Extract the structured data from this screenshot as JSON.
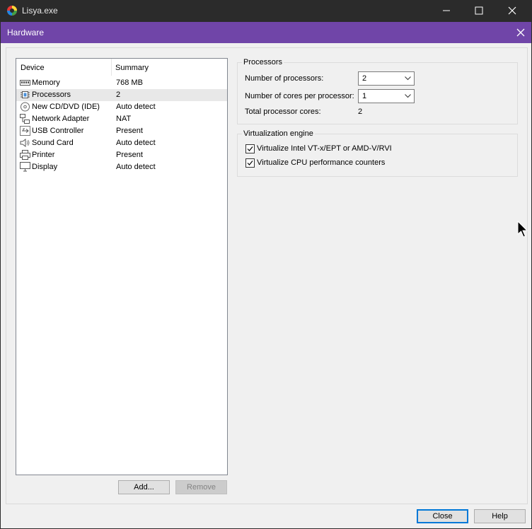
{
  "window": {
    "title": "Lisya.exe",
    "icon": "app-logo-icon"
  },
  "dialog": {
    "title": "Hardware"
  },
  "device_list": {
    "columns": [
      "Device",
      "Summary"
    ],
    "rows": [
      {
        "name": "Memory",
        "summary": "768 MB",
        "icon": "memory-icon",
        "selected": false
      },
      {
        "name": "Processors",
        "summary": "2",
        "icon": "processor-icon",
        "selected": true
      },
      {
        "name": "New CD/DVD (IDE)",
        "summary": "Auto detect",
        "icon": "cd-dvd-icon",
        "selected": false
      },
      {
        "name": "Network Adapter",
        "summary": "NAT",
        "icon": "network-adapter-icon",
        "selected": false
      },
      {
        "name": "USB Controller",
        "summary": "Present",
        "icon": "usb-icon",
        "selected": false
      },
      {
        "name": "Sound Card",
        "summary": "Auto detect",
        "icon": "speaker-icon",
        "selected": false
      },
      {
        "name": "Printer",
        "summary": "Present",
        "icon": "printer-icon",
        "selected": false
      },
      {
        "name": "Display",
        "summary": "Auto detect",
        "icon": "monitor-icon",
        "selected": false
      }
    ],
    "add_label": "Add...",
    "remove_label": "Remove"
  },
  "processors": {
    "group_title": "Processors",
    "num_processors_label": "Number of processors:",
    "num_processors_value": "2",
    "cores_label": "Number of cores per processor:",
    "cores_value": "1",
    "total_label": "Total processor cores:",
    "total_value": "2"
  },
  "virtualization": {
    "group_title": "Virtualization engine",
    "options": [
      {
        "label": "Virtualize Intel VT-x/EPT or AMD-V/RVI",
        "checked": true
      },
      {
        "label": "Virtualize CPU performance counters",
        "checked": true
      }
    ]
  },
  "footer": {
    "close_label": "Close",
    "help_label": "Help"
  },
  "colors": {
    "dialog_titlebar": "#7045a8",
    "outer_titlebar": "#2b2b2b",
    "default_button_border": "#0078d7"
  }
}
